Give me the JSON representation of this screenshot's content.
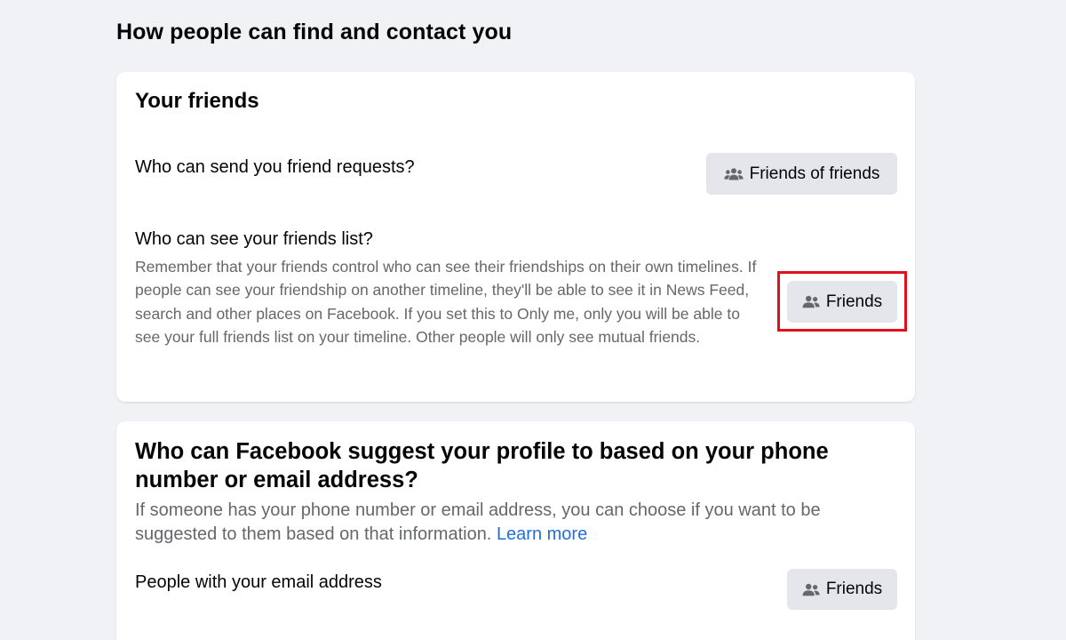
{
  "section": {
    "title": "How people can find and contact you"
  },
  "friends_card": {
    "title": "Your friends",
    "friend_requests": {
      "question": "Who can send you friend requests?",
      "button_label": "Friends of friends"
    },
    "friends_list": {
      "question": "Who can see your friends list?",
      "description": "Remember that your friends control who can see their friendships on their own timelines. If people can see your friendship on another timeline, they'll be able to see it in News Feed, search and other places on Facebook. If you set this to Only me, only you will be able to see your full friends list on your timeline. Other people will only see mutual friends.",
      "button_label": "Friends"
    }
  },
  "suggest_card": {
    "title": "Who can Facebook suggest your profile to based on your phone number or email address?",
    "description": "If someone has your phone number or email address, you can choose if you want to be suggested to them based on that information.",
    "learn_more": "Learn more",
    "email_setting": {
      "label": "People with your email address",
      "button_label": "Friends"
    }
  },
  "icons": {
    "friends_of_friends": "people-group-icon",
    "friends": "people-pair-icon"
  },
  "colors": {
    "page_background": "#f0f2f5",
    "card_background": "#ffffff",
    "button_background": "#e4e6eb",
    "secondary_text": "#65676b",
    "link": "#216fdb",
    "highlight_border": "#e0101e"
  }
}
